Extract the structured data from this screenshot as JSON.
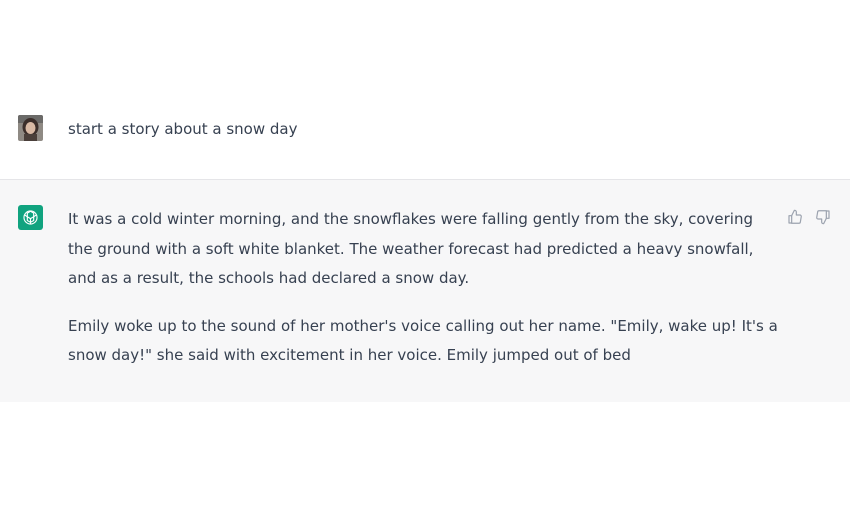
{
  "user_message": {
    "text": "start a story about a snow day"
  },
  "assistant_message": {
    "paragraphs": [
      "It was a cold winter morning, and the snowflakes were falling gently from the sky, covering the ground with a soft white blanket. The weather forecast had predicted a heavy snowfall, and as a result, the schools had declared a snow day.",
      "Emily woke up to the sound of her mother's voice calling out her name. \"Emily, wake up! It's a snow day!\" she said with excitement in her voice. Emily jumped out of bed"
    ]
  },
  "colors": {
    "assistant_bg": "#f7f7f8",
    "brand_green": "#10a37f",
    "text": "#374151"
  },
  "icons": {
    "bot_avatar": "openai-logo-icon",
    "thumbs_up": "thumbs-up-icon",
    "thumbs_down": "thumbs-down-icon"
  }
}
